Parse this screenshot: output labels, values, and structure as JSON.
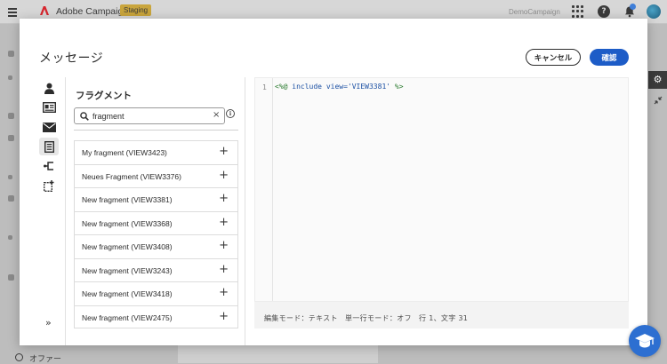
{
  "app": {
    "title": "Adobe Campaign",
    "environment": "Staging",
    "org": "DemoCampaign",
    "help_symbol": "?",
    "accent_color": "#1d5cc7"
  },
  "background": {
    "bottom_item": "オファー",
    "settings_icon": "⚙"
  },
  "modal": {
    "title": "メッセージ",
    "cancel_label": "キャンセル",
    "confirm_label": "確認"
  },
  "side_tools": [
    {
      "name": "personalization-profile-icon",
      "active": false
    },
    {
      "name": "contact-card-icon",
      "active": false
    },
    {
      "name": "message-envelope-icon",
      "active": false
    },
    {
      "name": "fragment-icon",
      "active": true
    },
    {
      "name": "conditional-branch-icon",
      "active": false
    },
    {
      "name": "helper-functions-icon",
      "active": false
    }
  ],
  "fragments_panel": {
    "heading": "フラグメント",
    "search_value": "fragment",
    "clear_symbol": "×",
    "info_symbol": "i",
    "add_symbol": "+",
    "items": [
      {
        "label": "My fragment (VIEW3423)"
      },
      {
        "label": "Neues Fragment (VIEW3376)"
      },
      {
        "label": "New fragment (VIEW3381)"
      },
      {
        "label": "New fragment (VIEW3368)"
      },
      {
        "label": "New fragment (VIEW3408)"
      },
      {
        "label": "New fragment (VIEW3243)"
      },
      {
        "label": "New fragment (VIEW3418)"
      },
      {
        "label": "New fragment (VIEW2475)"
      }
    ],
    "expand_symbol": "»"
  },
  "editor": {
    "line_number": "1",
    "code_open": "<%@",
    "code_keyword": "include view=",
    "code_value": "'VIEW3381'",
    "code_close": "%>",
    "status": "編集モード：テキスト　単一行モード：オフ　行 1、文字 31"
  }
}
